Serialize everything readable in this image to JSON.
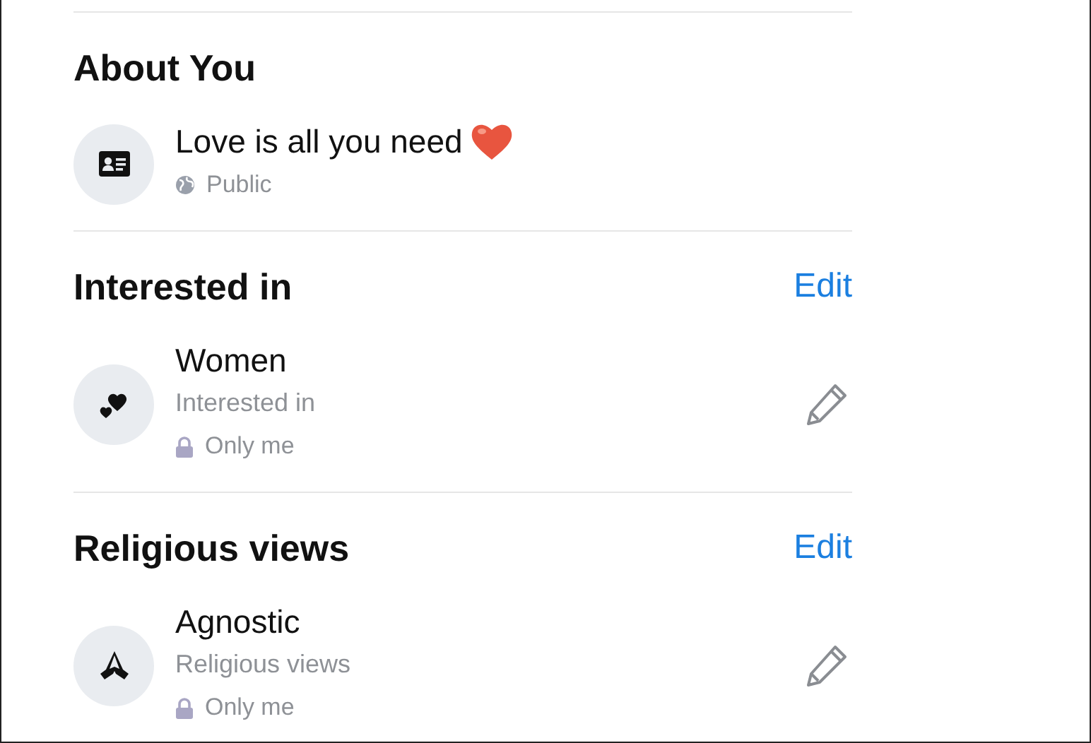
{
  "sections": [
    {
      "title": "About You",
      "items": [
        {
          "kind": "about",
          "title": "Love is all you need",
          "privacy": {
            "kind": "public",
            "label": "Public"
          },
          "editable": false
        }
      ]
    },
    {
      "title": "Interested in",
      "action": "Edit",
      "items": [
        {
          "kind": "interest",
          "title": "Women",
          "subtitle": "Interested in",
          "privacy": {
            "kind": "private",
            "label": "Only me"
          },
          "editable": true
        }
      ]
    },
    {
      "title": "Religious views",
      "action": "Edit",
      "items": [
        {
          "kind": "religion",
          "title": "Agnostic",
          "subtitle": "Religious views",
          "privacy": {
            "kind": "private",
            "label": "Only me"
          },
          "editable": true
        }
      ]
    }
  ]
}
